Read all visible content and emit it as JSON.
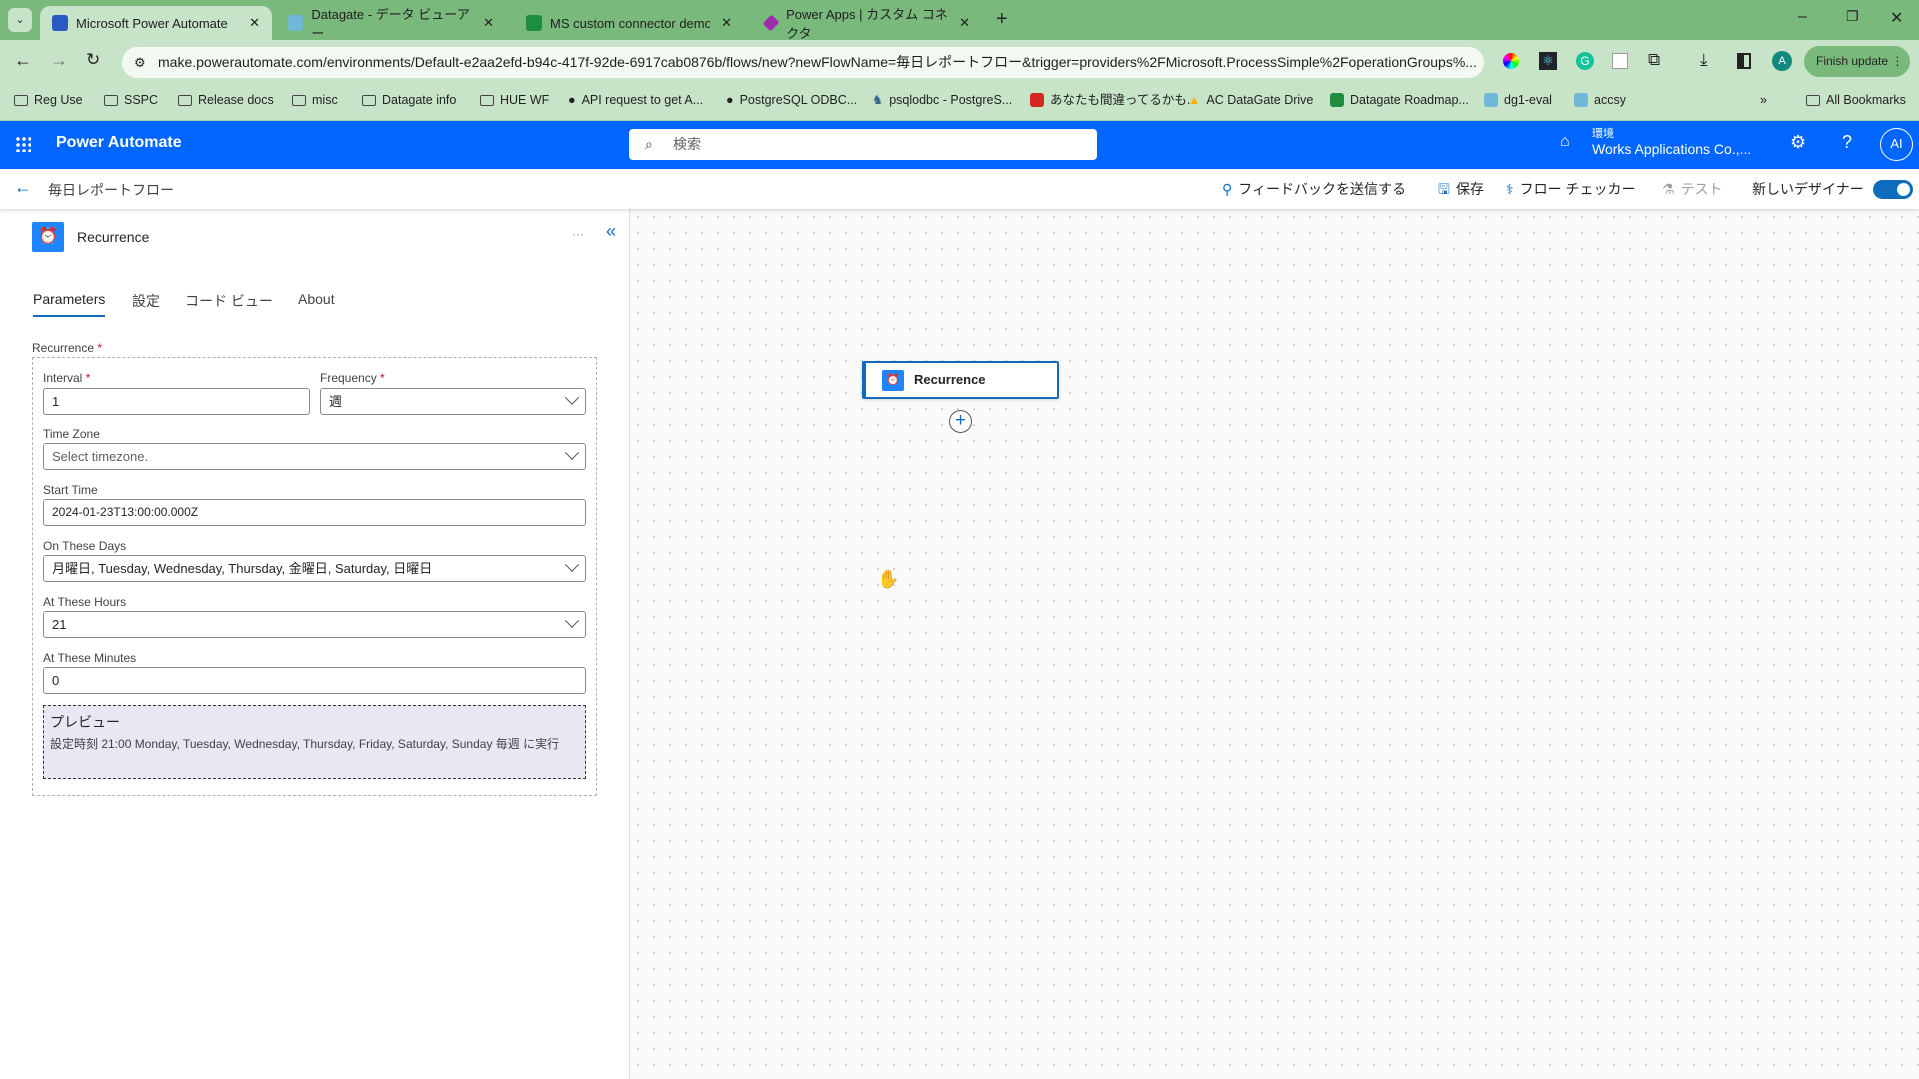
{
  "browser": {
    "tabs": [
      {
        "label": "Microsoft Power Automate",
        "active": true,
        "icon": "power-automate-icon",
        "color": "#2b59c3"
      },
      {
        "label": "Datagate - データ ビューアー",
        "icon": "datagate-icon",
        "color": "#6fb8d8"
      },
      {
        "label": "MS custom connector demo m",
        "icon": "sheets-icon",
        "color": "#1e8e3e"
      },
      {
        "label": "Power Apps | カスタム コネクタ",
        "icon": "power-apps-icon",
        "color": "#9b2fae"
      }
    ],
    "url": "make.powerautomate.com/environments/Default-e2aa2efd-b94c-417f-92de-6917cab0876b/flows/new?newFlowName=毎日レポートフロー&trigger=providers%2FMicrosoft.ProcessSimple%2FoperationGroups%...",
    "finish_update": "Finish update",
    "profile_initial": "A",
    "bookmarks": [
      "Reg Use",
      "SSPC",
      "Release docs",
      "misc",
      "Datagate info",
      "HUE WF",
      "API request to get A...",
      "PostgreSQL ODBC...",
      "psqlodbc - PostgreS...",
      "あなたも間違ってるかも...",
      "AC DataGate Drive",
      "Datagate Roadmap...",
      "dg1-eval",
      "accsy"
    ],
    "all_bookmarks": "All Bookmarks",
    "more": "»"
  },
  "app": {
    "title": "Power Automate",
    "search_placeholder": "検索",
    "env_label": "環境",
    "env_name": "Works Applications Co.,...",
    "avatar": "AI",
    "accent": "#0066ff"
  },
  "toolbar": {
    "flow_name": "毎日レポートフロー",
    "feedback": "フィードバックを送信する",
    "save": "保存",
    "checker": "フロー チェッカー",
    "test": "テスト",
    "new_designer": "新しいデザイナー",
    "new_designer_on": true
  },
  "panel": {
    "title": "Recurrence",
    "more": "···",
    "tabs": [
      "Parameters",
      "設定",
      "コード ビュー",
      "About"
    ],
    "active_tab": "Parameters",
    "group_label": "Recurrence",
    "required": "*",
    "fields": {
      "interval": {
        "label": "Interval",
        "value": "1"
      },
      "frequency": {
        "label": "Frequency",
        "value": "週"
      },
      "timezone": {
        "label": "Time Zone",
        "placeholder": "Select timezone."
      },
      "start_time": {
        "label": "Start Time",
        "value": "2024-01-23T13:00:00.000Z"
      },
      "days": {
        "label": "On These Days",
        "value": "月曜日, Tuesday, Wednesday, Thursday, 金曜日, Saturday, 日曜日"
      },
      "hours": {
        "label": "At These Hours",
        "value": "21"
      },
      "minutes": {
        "label": "At These Minutes",
        "value": "0"
      }
    },
    "preview": {
      "title": "プレビュー",
      "text": "設定時刻 21:00 Monday, Tuesday, Wednesday, Thursday, Friday, Saturday, Sunday 毎週 に実行"
    }
  },
  "canvas": {
    "node_label": "Recurrence"
  }
}
